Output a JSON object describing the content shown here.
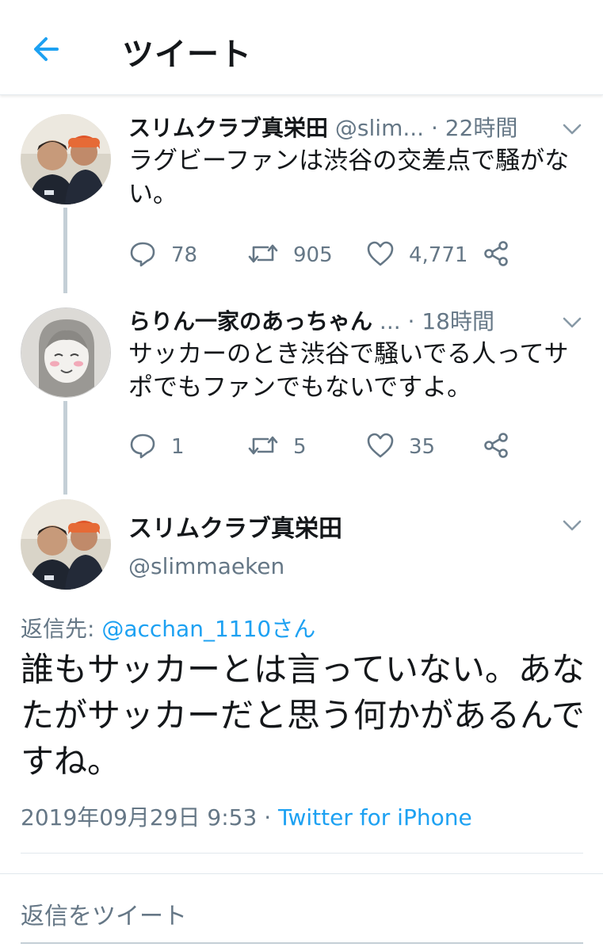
{
  "header": {
    "title": "ツイート"
  },
  "tweets": [
    {
      "name": "スリムクラブ真栄田",
      "handle": "@slim...",
      "time": "· 22時間",
      "text": "ラグビーファンは渋谷の交差点で騒がない。",
      "replies": "78",
      "retweets": "905",
      "likes": "4,771"
    },
    {
      "name": "らりん一家のあっちゃん",
      "handle": "...",
      "time": "· 18時間",
      "text": "サッカーのとき渋谷で騒いでる人ってサポでもファンでもないですよ。",
      "replies": "1",
      "retweets": "5",
      "likes": "35"
    }
  ],
  "main_tweet": {
    "name": "スリムクラブ真栄田",
    "handle": "@slimmaeken",
    "reply_to_label": "返信先:",
    "reply_to_user": "@acchan_1110さん",
    "text": "誰もサッカーとは言っていない。あなたがサッカーだと思う何かがあるんですね。",
    "timestamp": "2019年09月29日 9:53 ·",
    "source": "Twitter for iPhone"
  },
  "reply_bar": {
    "placeholder": "返信をツイート"
  },
  "colors": {
    "accent": "#1da1f2",
    "secondary_text": "#657786",
    "thread_line": "#c4cfd6"
  },
  "icons": [
    "back-arrow-icon",
    "chevron-down-icon",
    "reply-icon",
    "retweet-icon",
    "like-icon",
    "share-icon"
  ]
}
